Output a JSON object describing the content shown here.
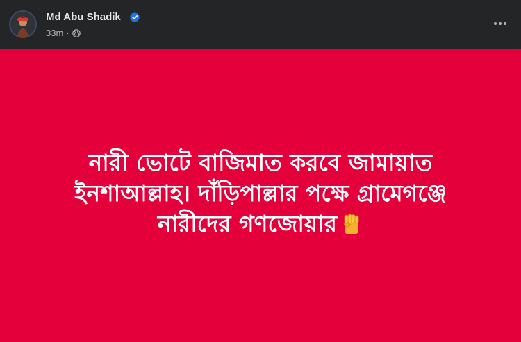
{
  "post": {
    "author": "Md Abu Shadik",
    "time": "33m",
    "separator": "·",
    "text_lines": [
      "নারী ভোটে বাজিমাত করবে জামায়াত",
      "ইনশাআল্লাহ। দাঁড়িপাল্লার পক্ষে গ্রামেগঞ্জে",
      "নারীদের গণজোয়ার"
    ]
  },
  "colors": {
    "header_bg": "#242526",
    "post_bg": "#e4003a",
    "verified": "#2374e1"
  },
  "icons": {
    "verified": "verified-badge-icon",
    "globe": "globe-icon",
    "more": "more-options-icon",
    "emoji": "raised-fist-emoji-icon"
  }
}
